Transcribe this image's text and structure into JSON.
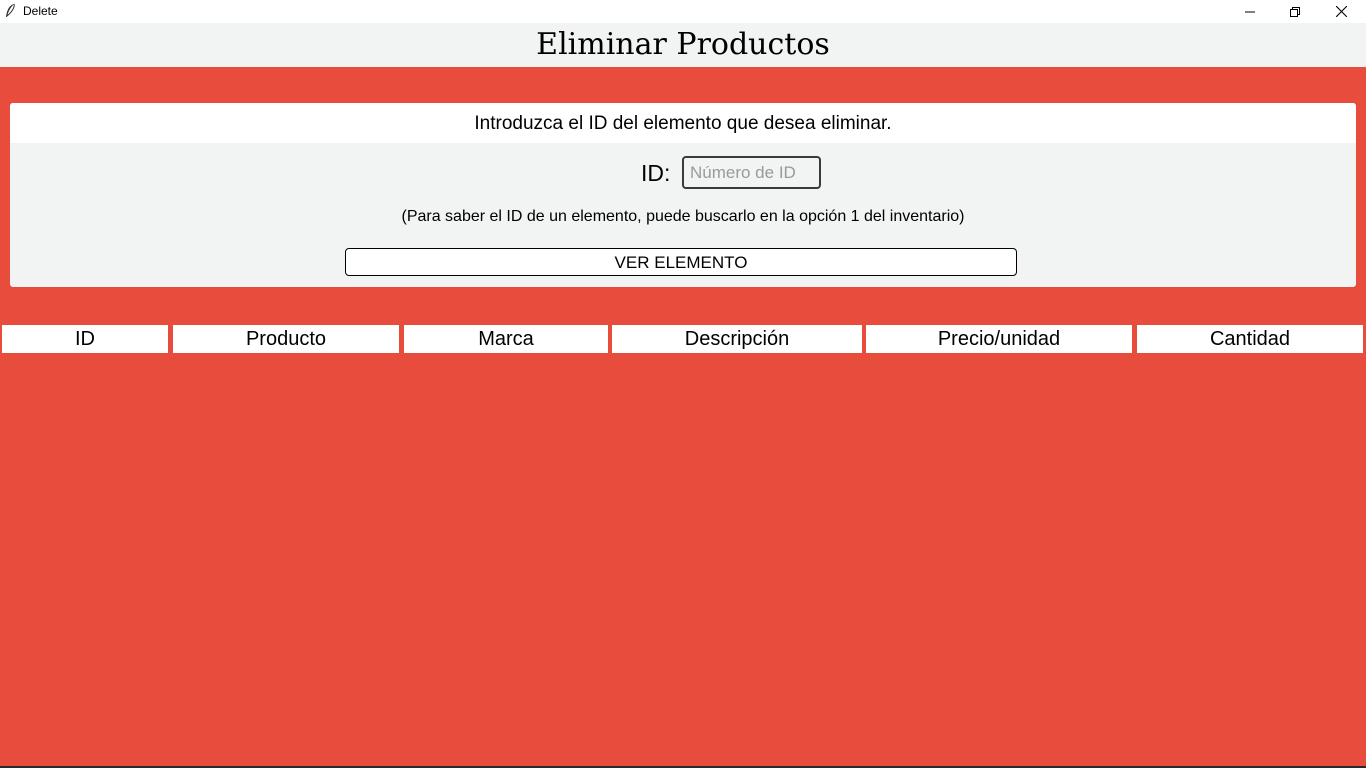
{
  "window": {
    "title": "Delete",
    "icon": "feather-icon",
    "controls": [
      "minimize-icon",
      "restore-icon",
      "close-icon"
    ]
  },
  "header": {
    "title": "Eliminar Productos"
  },
  "form": {
    "instruction": "Introduzca el ID del elemento que desea eliminar.",
    "id_label": "ID:",
    "id_placeholder": "Número de ID",
    "id_value": "",
    "hint": "(Para saber el ID de un elemento, puede buscarlo en la opción 1 del inventario)",
    "view_button_label": "VER ELEMENTO"
  },
  "table": {
    "columns": [
      "ID",
      "Producto",
      "Marca",
      "Descripción",
      "Precio/unidad",
      "Cantidad"
    ],
    "rows": []
  },
  "colors": {
    "background": "#e84c3d",
    "panel": "#f2f3f3",
    "header_bar": "#f2f3f3",
    "cell": "#ffffff"
  }
}
